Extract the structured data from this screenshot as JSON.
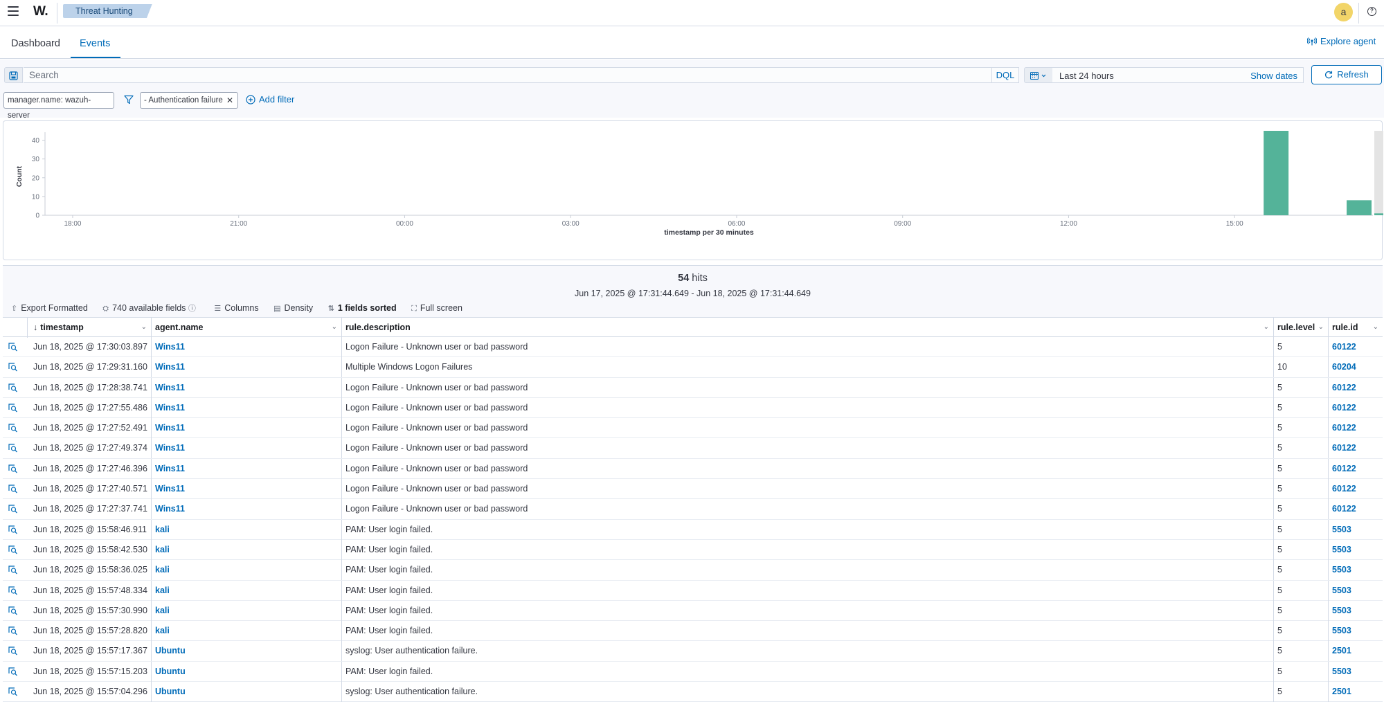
{
  "app": {
    "logo": "W.",
    "breadcrumb": "Threat Hunting",
    "avatar_initial": "a",
    "help_glyph": "?"
  },
  "tabs": [
    {
      "label": "Dashboard",
      "active": false
    },
    {
      "label": "Events",
      "active": true
    }
  ],
  "explore_agent": "Explore agent",
  "query": {
    "placeholder": "Search",
    "value": "",
    "language": "DQL",
    "date_range": "Last 24 hours",
    "show_dates": "Show dates",
    "refresh": "Refresh"
  },
  "filters": {
    "pinned": "manager.name: wazuh-server",
    "active": "- Authentication failure",
    "add_filter": "Add filter"
  },
  "chart_data": {
    "type": "bar",
    "title": "",
    "xlabel": "timestamp per 30 minutes",
    "ylabel": "Count",
    "ylim": [
      0,
      45
    ],
    "yticks": [
      0,
      10,
      20,
      30,
      40
    ],
    "xticks": [
      "18:00",
      "21:00",
      "00:00",
      "03:00",
      "06:00",
      "09:00",
      "12:00",
      "15:00"
    ],
    "x_start": "Jun 17, 2025 @ 17:30",
    "interval_minutes": 30,
    "grid": false,
    "series": [
      {
        "values": [
          {
            "bucket": "Jun 18, 2025 @ 15:30",
            "count": 45
          },
          {
            "bucket": "Jun 18, 2025 @ 17:00",
            "count": 8
          },
          {
            "bucket": "Jun 18, 2025 @ 17:30",
            "count": 1
          }
        ]
      }
    ],
    "partial_bucket": {
      "bucket": "Jun 18, 2025 @ 17:30",
      "count": 45
    }
  },
  "colors": {
    "bar": "#54b399",
    "partial": "#e4e4e4",
    "link": "#006bb8"
  },
  "results": {
    "hits_count": "54",
    "hits_label": "hits",
    "time_range": "Jun 17, 2025 @ 17:31:44.649 - Jun 18, 2025 @ 17:31:44.649",
    "toolbar": {
      "export": "Export Formatted",
      "fields": "740 available fields",
      "columns": "Columns",
      "density": "Density",
      "sorted": "1 fields sorted",
      "fullscreen": "Full screen"
    }
  },
  "table": {
    "columns": [
      "timestamp",
      "agent.name",
      "rule.description",
      "rule.level",
      "rule.id"
    ],
    "rows": [
      {
        "timestamp": "Jun 18, 2025 @ 17:30:03.897",
        "agent": "Wins11",
        "description": "Logon Failure - Unknown user or bad password",
        "level": "5",
        "id": "60122"
      },
      {
        "timestamp": "Jun 18, 2025 @ 17:29:31.160",
        "agent": "Wins11",
        "description": "Multiple Windows Logon Failures",
        "level": "10",
        "id": "60204"
      },
      {
        "timestamp": "Jun 18, 2025 @ 17:28:38.741",
        "agent": "Wins11",
        "description": "Logon Failure - Unknown user or bad password",
        "level": "5",
        "id": "60122"
      },
      {
        "timestamp": "Jun 18, 2025 @ 17:27:55.486",
        "agent": "Wins11",
        "description": "Logon Failure - Unknown user or bad password",
        "level": "5",
        "id": "60122"
      },
      {
        "timestamp": "Jun 18, 2025 @ 17:27:52.491",
        "agent": "Wins11",
        "description": "Logon Failure - Unknown user or bad password",
        "level": "5",
        "id": "60122"
      },
      {
        "timestamp": "Jun 18, 2025 @ 17:27:49.374",
        "agent": "Wins11",
        "description": "Logon Failure - Unknown user or bad password",
        "level": "5",
        "id": "60122"
      },
      {
        "timestamp": "Jun 18, 2025 @ 17:27:46.396",
        "agent": "Wins11",
        "description": "Logon Failure - Unknown user or bad password",
        "level": "5",
        "id": "60122"
      },
      {
        "timestamp": "Jun 18, 2025 @ 17:27:40.571",
        "agent": "Wins11",
        "description": "Logon Failure - Unknown user or bad password",
        "level": "5",
        "id": "60122"
      },
      {
        "timestamp": "Jun 18, 2025 @ 17:27:37.741",
        "agent": "Wins11",
        "description": "Logon Failure - Unknown user or bad password",
        "level": "5",
        "id": "60122"
      },
      {
        "timestamp": "Jun 18, 2025 @ 15:58:46.911",
        "agent": "kali",
        "description": "PAM: User login failed.",
        "level": "5",
        "id": "5503"
      },
      {
        "timestamp": "Jun 18, 2025 @ 15:58:42.530",
        "agent": "kali",
        "description": "PAM: User login failed.",
        "level": "5",
        "id": "5503"
      },
      {
        "timestamp": "Jun 18, 2025 @ 15:58:36.025",
        "agent": "kali",
        "description": "PAM: User login failed.",
        "level": "5",
        "id": "5503"
      },
      {
        "timestamp": "Jun 18, 2025 @ 15:57:48.334",
        "agent": "kali",
        "description": "PAM: User login failed.",
        "level": "5",
        "id": "5503"
      },
      {
        "timestamp": "Jun 18, 2025 @ 15:57:30.990",
        "agent": "kali",
        "description": "PAM: User login failed.",
        "level": "5",
        "id": "5503"
      },
      {
        "timestamp": "Jun 18, 2025 @ 15:57:28.820",
        "agent": "kali",
        "description": "PAM: User login failed.",
        "level": "5",
        "id": "5503"
      },
      {
        "timestamp": "Jun 18, 2025 @ 15:57:17.367",
        "agent": "Ubuntu",
        "description": "syslog: User authentication failure.",
        "level": "5",
        "id": "2501"
      },
      {
        "timestamp": "Jun 18, 2025 @ 15:57:15.203",
        "agent": "Ubuntu",
        "description": "PAM: User login failed.",
        "level": "5",
        "id": "5503"
      },
      {
        "timestamp": "Jun 18, 2025 @ 15:57:04.296",
        "agent": "Ubuntu",
        "description": "syslog: User authentication failure.",
        "level": "5",
        "id": "2501"
      }
    ]
  }
}
